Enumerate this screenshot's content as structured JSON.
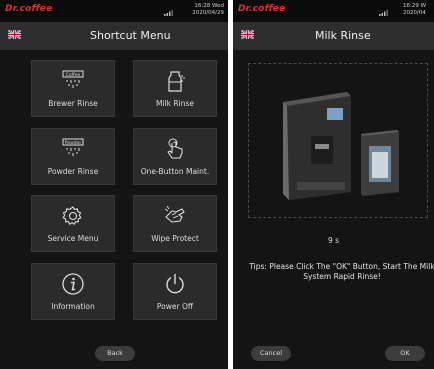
{
  "left": {
    "logo": "Dr.coffee",
    "status_time": "16:28 Wed",
    "status_date": "2020/04/29",
    "title": "Shortcut Menu",
    "tiles": [
      {
        "label": "Brewer Rinse",
        "icon": "brewer-rinse-icon",
        "icon_text": "Coffee"
      },
      {
        "label": "Milk Rinse",
        "icon": "milk-rinse-icon"
      },
      {
        "label": "Powder Rinse",
        "icon": "powder-rinse-icon",
        "icon_text": "Powder"
      },
      {
        "label": "One-Button Maint.",
        "icon": "touch-hand-icon"
      },
      {
        "label": "Service Menu",
        "icon": "gear-icon"
      },
      {
        "label": "Wipe Protect",
        "icon": "wipe-hand-icon"
      },
      {
        "label": "Information",
        "icon": "info-icon"
      },
      {
        "label": "Power Off",
        "icon": "power-icon"
      }
    ],
    "back_label": "Back"
  },
  "right": {
    "logo": "Dr.coffee",
    "status_time": "16:29 W",
    "status_date": "2020/04",
    "title": "Milk Rinse",
    "countdown": "9 s",
    "tips_line1": "Tips: Please Click The \"OK\" Button, Start The Milk",
    "tips_line2": "System Rapid Rinse!",
    "cancel_label": "Cancel",
    "ok_label": "OK"
  },
  "colors": {
    "background": "#141414",
    "title_bar": "#2e2e2e",
    "tile": "#2b2b2b",
    "logo_red": "#e03030",
    "button": "#3c3c3c"
  }
}
